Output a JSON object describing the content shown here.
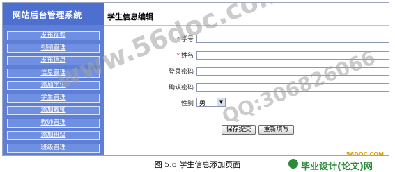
{
  "sidebar": {
    "title": "网站后台管理系统",
    "items": [
      {
        "label": "发布视频"
      },
      {
        "label": "视频管理"
      },
      {
        "label": "发布信息"
      },
      {
        "label": "信息管理"
      },
      {
        "label": "添加学生"
      },
      {
        "label": "学生管理"
      },
      {
        "label": "添加教师"
      },
      {
        "label": "教师管理"
      },
      {
        "label": "添加班级"
      },
      {
        "label": "班级管理"
      }
    ]
  },
  "main": {
    "title": "学生信息编辑",
    "fields": {
      "student_id_label": "学号",
      "name_label": "姓名",
      "password_label": "登录密码",
      "confirm_password_label": "确认密码",
      "gender_label": "性别",
      "gender_value": "男",
      "required_mark": "*"
    },
    "buttons": {
      "submit": "保存提交",
      "reset": "重新填写"
    }
  },
  "watermarks": {
    "site": "www.56doc.com",
    "qq": "QQ:306826066"
  },
  "caption": "图 5.6  学生信息添加页面",
  "branding": {
    "site_small": "56DOC.COM",
    "name": "毕业设计(论文)网"
  },
  "colors": {
    "sidebar": "#5f7fd6",
    "sidebar_item": "#6f8fe2",
    "required": "#d40000",
    "brand": "#2c8a3a"
  }
}
